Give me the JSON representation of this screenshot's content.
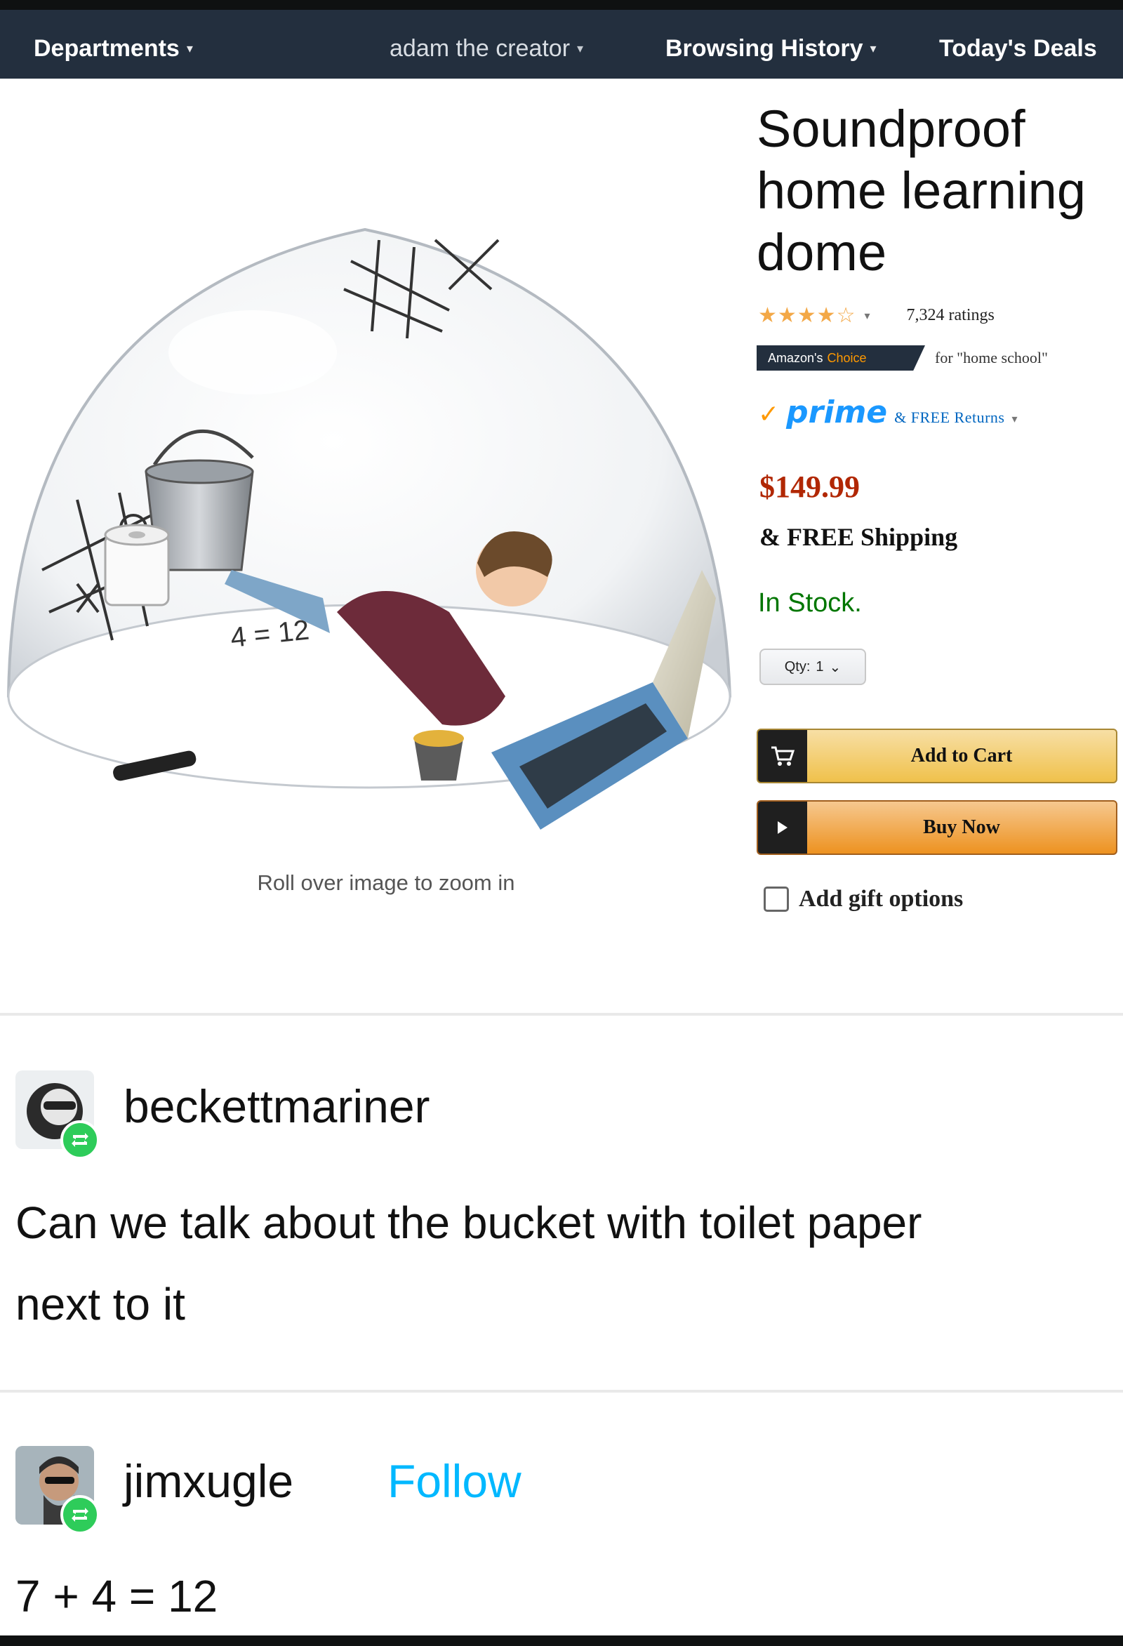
{
  "navbar": {
    "departments": "Departments",
    "account": "adam the creator",
    "history": "Browsing History",
    "deals": "Today's Deals"
  },
  "product": {
    "title": "Soundproof home learning dome",
    "image_caption": "Roll over image to zoom in",
    "image_alt": "Clear plastic dome over a child",
    "image_math": "4 = 12",
    "rating_stars": 4.5,
    "ratings_count": "7,324 ratings",
    "badge_main": "Amazon's",
    "badge_sub": "Choice",
    "badge_for": "for \"home school\"",
    "prime_label": "prime",
    "returns_label": "& FREE Returns",
    "price": "$149.99",
    "shipping": "& FREE Shipping",
    "stock": "In Stock.",
    "qty_label": "Qty:",
    "qty_value": "1",
    "add_to_cart": "Add to Cart",
    "buy_now": "Buy Now",
    "gift_options": "Add gift options"
  },
  "posts": [
    {
      "username": "beckettmariner",
      "text": "Can we talk about the bucket with toilet paper next to it"
    },
    {
      "username": "jimxugle",
      "follow_label": "Follow",
      "text": "7 + 4 = 12"
    }
  ],
  "colors": {
    "navbar": "#232f3e",
    "price": "#b12704",
    "stock": "#007600",
    "prime": "#1a98ff",
    "cart_button": "#f0c14b",
    "buy_button": "#ed9220",
    "reblog": "#2ecc5a",
    "follow": "#00b8ff"
  }
}
